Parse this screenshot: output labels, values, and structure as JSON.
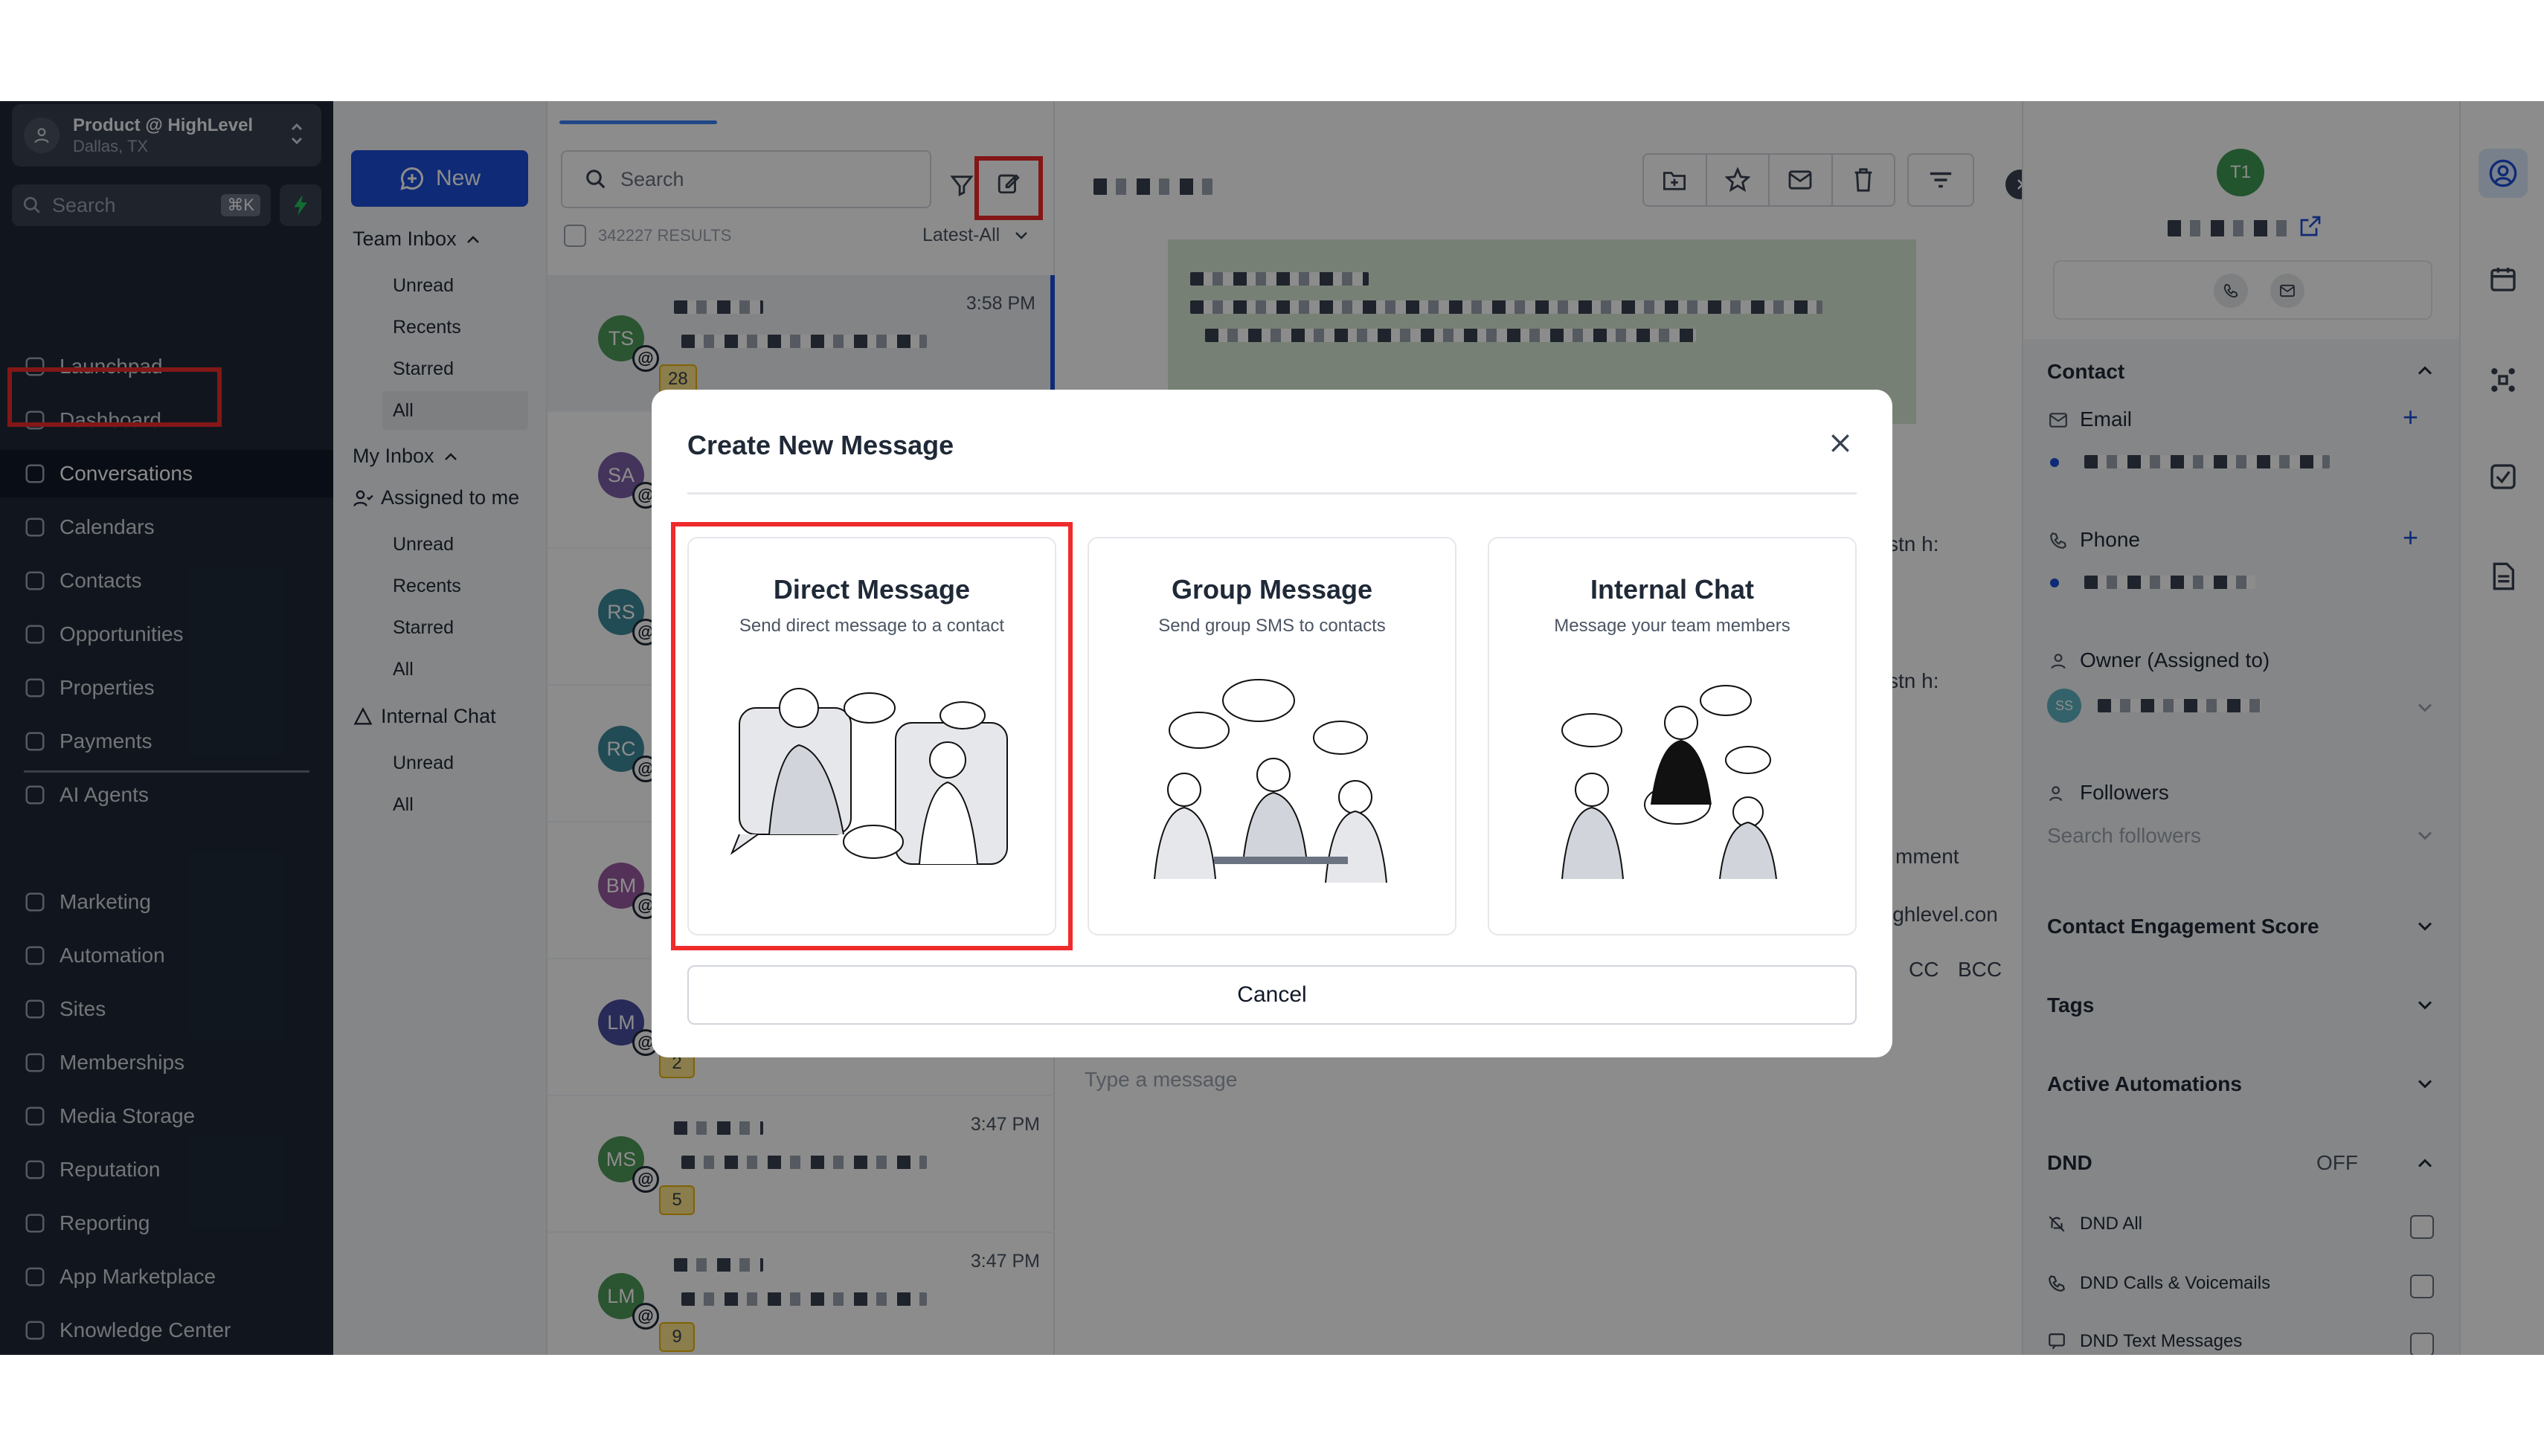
{
  "account": {
    "name": "Product @ HighLevel",
    "location": "Dallas, TX"
  },
  "sidebar_search": {
    "placeholder": "Search",
    "shortcut": "⌘K"
  },
  "nav": [
    "Launchpad",
    "Dashboard",
    "Conversations",
    "Calendars",
    "Contacts",
    "Opportunities",
    "Properties",
    "Payments",
    "AI Agents",
    "Marketing",
    "Automation",
    "Sites",
    "Memberships",
    "Media Storage",
    "Reputation",
    "Reporting",
    "App Marketplace",
    "Knowledge Center"
  ],
  "inbox": {
    "new_label": "New",
    "team_inbox": "Team Inbox",
    "team_items": [
      "Unread",
      "Recents",
      "Starred",
      "All"
    ],
    "my_inbox": "My Inbox",
    "assigned": "Assigned to me",
    "my_items": [
      "Unread",
      "Recents",
      "Starred",
      "All"
    ],
    "internal_chat": "Internal Chat",
    "chat_items": [
      "Unread",
      "All"
    ]
  },
  "list": {
    "search_placeholder": "Search",
    "results": "342227 RESULTS",
    "sort": "Latest-All",
    "rows": [
      {
        "initials": "TS",
        "time": "3:58 PM",
        "count": "28",
        "color": "#4f9a5a"
      },
      {
        "initials": "SA",
        "time": "",
        "count": "",
        "color": "#7c5fa8"
      },
      {
        "initials": "RS",
        "time": "",
        "count": "",
        "color": "#3e8a9b"
      },
      {
        "initials": "RC",
        "time": "",
        "count": "",
        "color": "#3e8a9b"
      },
      {
        "initials": "BM",
        "time": "",
        "count": "",
        "color": "#9a5aa0"
      },
      {
        "initials": "LM",
        "time": "",
        "count": "2",
        "color": "#4a4fa0"
      },
      {
        "initials": "MS",
        "time": "3:47 PM",
        "count": "5",
        "color": "#4f9a5a"
      },
      {
        "initials": "LM",
        "time": "3:47 PM",
        "count": "9",
        "color": "#4f9a5a"
      }
    ]
  },
  "main": {
    "composer_placeholder": "Type a message",
    "partial_texts": [
      "stn h:",
      "stn h:",
      "mment",
      "ighlevel.con",
      "CC",
      "BCC"
    ]
  },
  "contact": {
    "initials": "T1",
    "section_contact": "Contact",
    "email_label": "Email",
    "phone_label": "Phone",
    "owner_label": "Owner (Assigned to)",
    "owner_initials": "SS",
    "followers_label": "Followers",
    "followers_placeholder": "Search followers",
    "engagement": "Contact Engagement Score",
    "tags": "Tags",
    "automations": "Active Automations",
    "dnd": "DND",
    "dnd_state": "OFF",
    "dnd_all": "DND All",
    "dnd_calls": "DND Calls & Voicemails",
    "dnd_text": "DND Text Messages"
  },
  "modal": {
    "title": "Create New Message",
    "options": [
      {
        "title": "Direct Message",
        "desc": "Send direct message to a contact"
      },
      {
        "title": "Group Message",
        "desc": "Send group SMS to contacts"
      },
      {
        "title": "Internal Chat",
        "desc": "Message your team members"
      }
    ],
    "cancel": "Cancel"
  },
  "colors": {
    "accent": "#1d4ed8",
    "highlight": "#ef2b2b",
    "sidebar": "#1f2937"
  }
}
